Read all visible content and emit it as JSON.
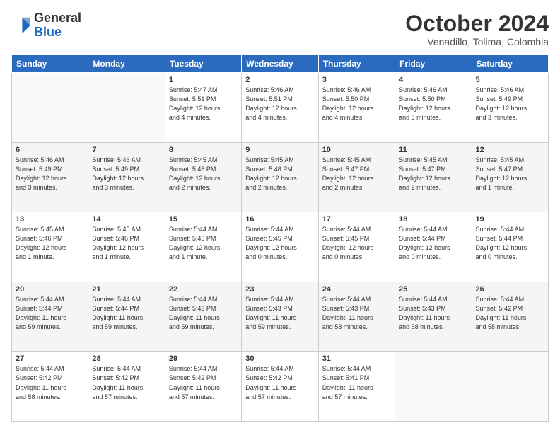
{
  "logo": {
    "general": "General",
    "blue": "Blue"
  },
  "header": {
    "month": "October 2024",
    "location": "Venadillo, Tolima, Colombia"
  },
  "weekdays": [
    "Sunday",
    "Monday",
    "Tuesday",
    "Wednesday",
    "Thursday",
    "Friday",
    "Saturday"
  ],
  "weeks": [
    [
      {
        "day": "",
        "info": ""
      },
      {
        "day": "",
        "info": ""
      },
      {
        "day": "1",
        "info": "Sunrise: 5:47 AM\nSunset: 5:51 PM\nDaylight: 12 hours\nand 4 minutes."
      },
      {
        "day": "2",
        "info": "Sunrise: 5:46 AM\nSunset: 5:51 PM\nDaylight: 12 hours\nand 4 minutes."
      },
      {
        "day": "3",
        "info": "Sunrise: 5:46 AM\nSunset: 5:50 PM\nDaylight: 12 hours\nand 4 minutes."
      },
      {
        "day": "4",
        "info": "Sunrise: 5:46 AM\nSunset: 5:50 PM\nDaylight: 12 hours\nand 3 minutes."
      },
      {
        "day": "5",
        "info": "Sunrise: 5:46 AM\nSunset: 5:49 PM\nDaylight: 12 hours\nand 3 minutes."
      }
    ],
    [
      {
        "day": "6",
        "info": "Sunrise: 5:46 AM\nSunset: 5:49 PM\nDaylight: 12 hours\nand 3 minutes."
      },
      {
        "day": "7",
        "info": "Sunrise: 5:46 AM\nSunset: 5:49 PM\nDaylight: 12 hours\nand 3 minutes."
      },
      {
        "day": "8",
        "info": "Sunrise: 5:45 AM\nSunset: 5:48 PM\nDaylight: 12 hours\nand 2 minutes."
      },
      {
        "day": "9",
        "info": "Sunrise: 5:45 AM\nSunset: 5:48 PM\nDaylight: 12 hours\nand 2 minutes."
      },
      {
        "day": "10",
        "info": "Sunrise: 5:45 AM\nSunset: 5:47 PM\nDaylight: 12 hours\nand 2 minutes."
      },
      {
        "day": "11",
        "info": "Sunrise: 5:45 AM\nSunset: 5:47 PM\nDaylight: 12 hours\nand 2 minutes."
      },
      {
        "day": "12",
        "info": "Sunrise: 5:45 AM\nSunset: 5:47 PM\nDaylight: 12 hours\nand 1 minute."
      }
    ],
    [
      {
        "day": "13",
        "info": "Sunrise: 5:45 AM\nSunset: 5:46 PM\nDaylight: 12 hours\nand 1 minute."
      },
      {
        "day": "14",
        "info": "Sunrise: 5:45 AM\nSunset: 5:46 PM\nDaylight: 12 hours\nand 1 minute."
      },
      {
        "day": "15",
        "info": "Sunrise: 5:44 AM\nSunset: 5:45 PM\nDaylight: 12 hours\nand 1 minute."
      },
      {
        "day": "16",
        "info": "Sunrise: 5:44 AM\nSunset: 5:45 PM\nDaylight: 12 hours\nand 0 minutes."
      },
      {
        "day": "17",
        "info": "Sunrise: 5:44 AM\nSunset: 5:45 PM\nDaylight: 12 hours\nand 0 minutes."
      },
      {
        "day": "18",
        "info": "Sunrise: 5:44 AM\nSunset: 5:44 PM\nDaylight: 12 hours\nand 0 minutes."
      },
      {
        "day": "19",
        "info": "Sunrise: 5:44 AM\nSunset: 5:44 PM\nDaylight: 12 hours\nand 0 minutes."
      }
    ],
    [
      {
        "day": "20",
        "info": "Sunrise: 5:44 AM\nSunset: 5:44 PM\nDaylight: 11 hours\nand 59 minutes."
      },
      {
        "day": "21",
        "info": "Sunrise: 5:44 AM\nSunset: 5:44 PM\nDaylight: 11 hours\nand 59 minutes."
      },
      {
        "day": "22",
        "info": "Sunrise: 5:44 AM\nSunset: 5:43 PM\nDaylight: 11 hours\nand 59 minutes."
      },
      {
        "day": "23",
        "info": "Sunrise: 5:44 AM\nSunset: 5:43 PM\nDaylight: 11 hours\nand 59 minutes."
      },
      {
        "day": "24",
        "info": "Sunrise: 5:44 AM\nSunset: 5:43 PM\nDaylight: 11 hours\nand 58 minutes."
      },
      {
        "day": "25",
        "info": "Sunrise: 5:44 AM\nSunset: 5:43 PM\nDaylight: 11 hours\nand 58 minutes."
      },
      {
        "day": "26",
        "info": "Sunrise: 5:44 AM\nSunset: 5:42 PM\nDaylight: 11 hours\nand 58 minutes."
      }
    ],
    [
      {
        "day": "27",
        "info": "Sunrise: 5:44 AM\nSunset: 5:42 PM\nDaylight: 11 hours\nand 58 minutes."
      },
      {
        "day": "28",
        "info": "Sunrise: 5:44 AM\nSunset: 5:42 PM\nDaylight: 11 hours\nand 57 minutes."
      },
      {
        "day": "29",
        "info": "Sunrise: 5:44 AM\nSunset: 5:42 PM\nDaylight: 11 hours\nand 57 minutes."
      },
      {
        "day": "30",
        "info": "Sunrise: 5:44 AM\nSunset: 5:42 PM\nDaylight: 11 hours\nand 57 minutes."
      },
      {
        "day": "31",
        "info": "Sunrise: 5:44 AM\nSunset: 5:41 PM\nDaylight: 11 hours\nand 57 minutes."
      },
      {
        "day": "",
        "info": ""
      },
      {
        "day": "",
        "info": ""
      }
    ]
  ]
}
